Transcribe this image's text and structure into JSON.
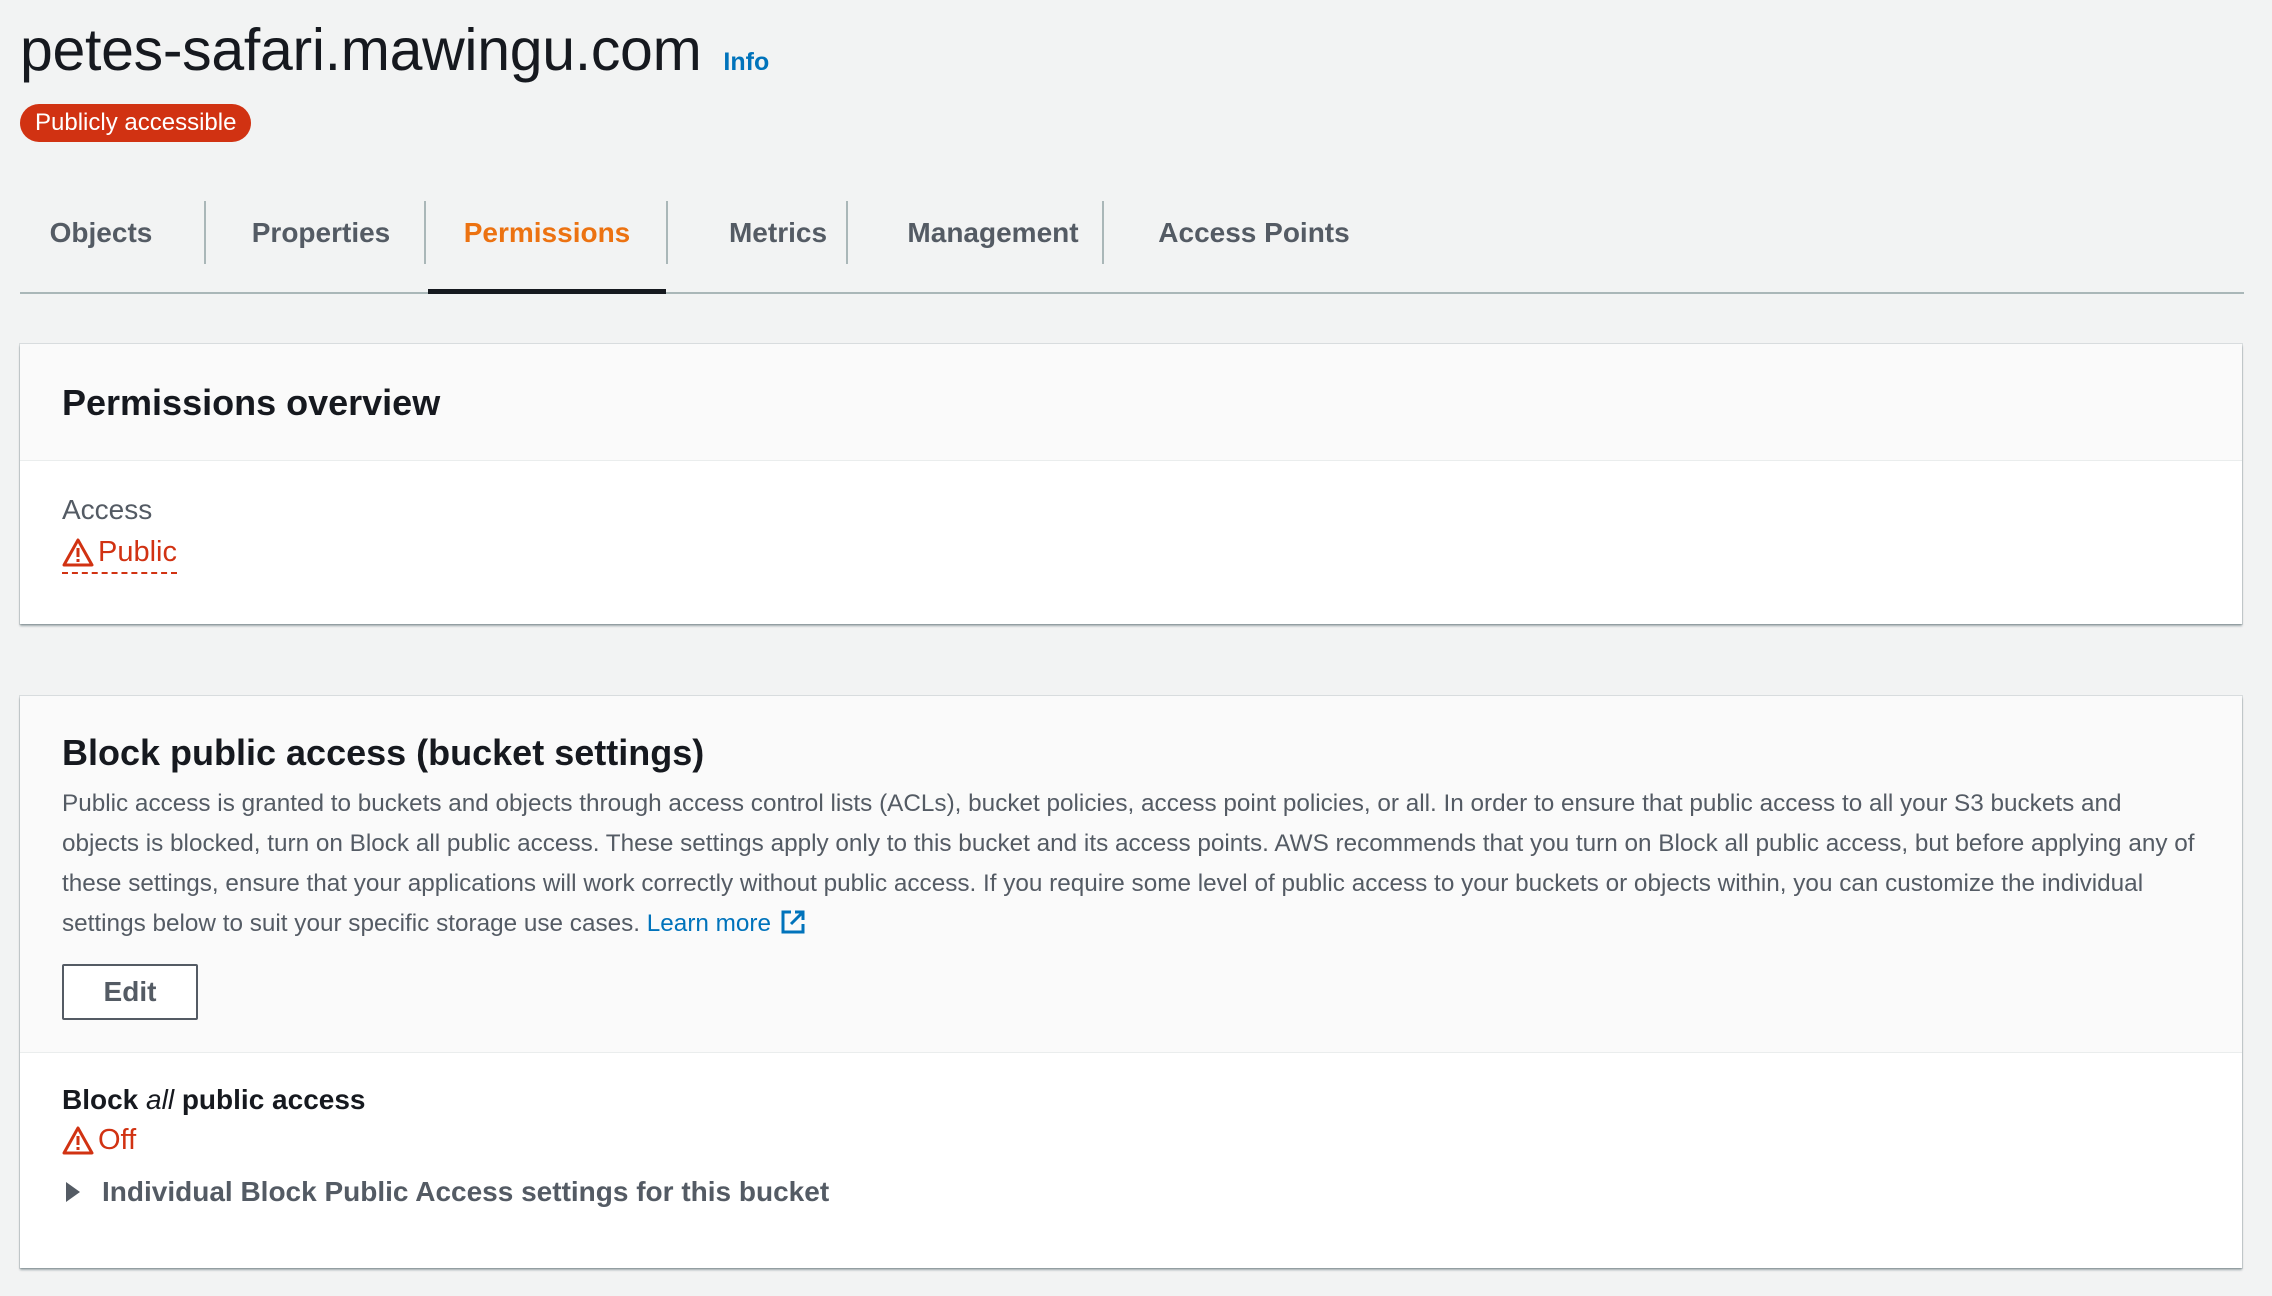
{
  "header": {
    "title": "petes-safari.mawingu.com",
    "info_link": "Info",
    "badge": "Publicly accessible"
  },
  "tabs": [
    {
      "label": "Objects",
      "active": false
    },
    {
      "label": "Properties",
      "active": false
    },
    {
      "label": "Permissions",
      "active": true
    },
    {
      "label": "Metrics",
      "active": false
    },
    {
      "label": "Management",
      "active": false
    },
    {
      "label": "Access Points",
      "active": false
    }
  ],
  "overview": {
    "title": "Permissions overview",
    "access_label": "Access",
    "access_value": "Public"
  },
  "block_public_access": {
    "title": "Block public access (bucket settings)",
    "description": "Public access is granted to buckets and objects through access control lists (ACLs), bucket policies, access point policies, or all. In order to ensure that public access to all your S3 buckets and objects is blocked, turn on Block all public access. These settings apply only to this bucket and its access points. AWS recommends that you turn on Block all public access, but before applying any of these settings, ensure that your applications will work correctly without public access. If you require some level of public access to your buckets or objects within, you can customize the individual settings below to suit your specific storage use cases.",
    "learn_more": "Learn more",
    "edit_button": "Edit",
    "setting_label_pre": "Block ",
    "setting_label_em": "all",
    "setting_label_post": " public access",
    "setting_value": "Off",
    "expander_label": "Individual Block Public Access settings for this bucket"
  },
  "colors": {
    "accent": "#ec7211",
    "link": "#0073bb",
    "danger": "#d13212",
    "background": "#f2f3f3"
  },
  "icons": [
    "warning-icon",
    "external-link-icon",
    "caret-right-icon"
  ]
}
